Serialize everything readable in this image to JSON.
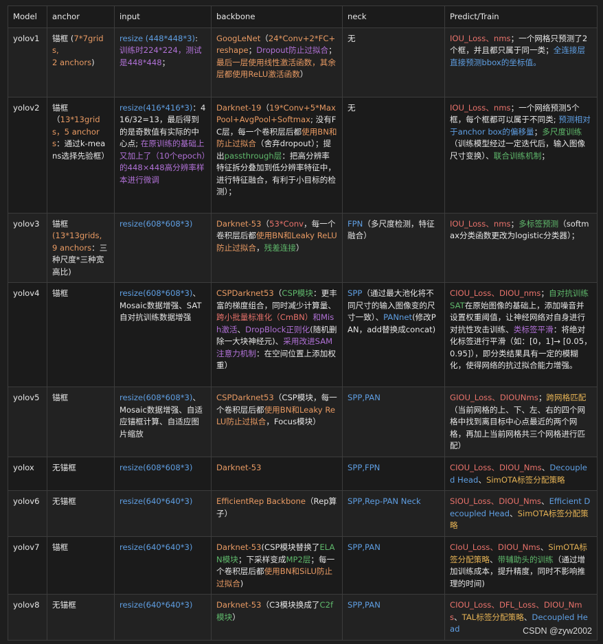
{
  "colors": {
    "text": "#e6e6e6",
    "orange": "#e89a63",
    "blue": "#5f9fe3",
    "green": "#5fb86b",
    "purple": "#b071d6",
    "red": "#e8726b",
    "yellow": "#e3b154",
    "cyan": "#4fc1c9"
  },
  "table": {
    "headers": [
      "Model",
      "anchor",
      "input",
      "backbone",
      "neck",
      "Predict/Train"
    ],
    "rows": [
      {
        "model": "yolov1",
        "anchor": [
          {
            "t": "锚框 ("
          },
          {
            "t": "7*7grids,\n2 anchors",
            "c": "orange"
          },
          {
            "t": ")"
          }
        ],
        "input": [
          {
            "t": "resize (448*448*3)",
            "c": "blue"
          },
          {
            "t": ": "
          },
          {
            "t": "训练时224*224，测试是448*448",
            "c": "purple"
          },
          {
            "t": "；"
          }
        ],
        "backbone": [
          {
            "t": "GoogLeNet",
            "c": "orange"
          },
          {
            "t": "（"
          },
          {
            "t": "24*Conv+2*FC+reshape",
            "c": "orange"
          },
          {
            "t": "；"
          },
          {
            "t": "Dropout防止过拟合",
            "c": "purple"
          },
          {
            "t": "；"
          },
          {
            "t": "最后一层使用线性激活函数，其余层都使用ReLU激活函数",
            "c": "orange"
          },
          {
            "t": "）"
          }
        ],
        "neck": [
          {
            "t": "无"
          }
        ],
        "predict": [
          {
            "t": "IOU_Loss、nms",
            "c": "red"
          },
          {
            "t": "；一个网格只预测了2个框，并且都只属于同一类；"
          },
          {
            "t": "全连接层直接预测bbox的坐标值。",
            "c": "blue"
          }
        ]
      },
      {
        "model": "yolov2",
        "anchor": [
          {
            "t": "锚框\n（"
          },
          {
            "t": "13*13grids，5 anchors",
            "c": "orange"
          },
          {
            "t": "：通过k-means选择先验框）"
          }
        ],
        "input": [
          {
            "t": "resize(416*416*3)",
            "c": "blue"
          },
          {
            "t": "：416/32=13，最后得到的是奇数值有实际的中心点; "
          },
          {
            "t": "在原训练的基础上又加上了（10个epoch）的448×448高分辨率样本进行微调",
            "c": "purple"
          }
        ],
        "backbone": [
          {
            "t": "Darknet-19",
            "c": "orange"
          },
          {
            "t": "（"
          },
          {
            "t": "19*Conv+5*MaxPool+AvgPool+Softmax",
            "c": "orange"
          },
          {
            "t": "; 没有FC层，每一个卷积层后都"
          },
          {
            "t": "使用BN和防止过拟合",
            "c": "orange"
          },
          {
            "t": "（舍弃dropout）；提出"
          },
          {
            "t": "passthrough层",
            "c": "green"
          },
          {
            "t": "：把高分辨率特征拆分叠加到低分辨率特征中，进行特征融合，有利于小目标的检测）；"
          }
        ],
        "neck": [
          {
            "t": "无"
          }
        ],
        "predict": [
          {
            "t": "IOU_Loss、nms",
            "c": "red"
          },
          {
            "t": "；一个网络预测5个框，每个框都可以属于不同类; "
          },
          {
            "t": "预测相对于anchor box的偏移量",
            "c": "blue"
          },
          {
            "t": "；"
          },
          {
            "t": "多尺度训练",
            "c": "green"
          },
          {
            "t": "（训练模型经过一定迭代后，输入图像尺寸变换）、"
          },
          {
            "t": "联合训练机制",
            "c": "green"
          },
          {
            "t": "；"
          }
        ]
      },
      {
        "model": "yolov3",
        "anchor": [
          {
            "t": "锚框\n"
          },
          {
            "t": "(13*13grids, 9 anchors",
            "c": "orange"
          },
          {
            "t": "：三种尺度*三种宽高比)"
          }
        ],
        "input": [
          {
            "t": "resize(608*608*3)",
            "c": "blue"
          }
        ],
        "backbone": [
          {
            "t": "Darknet-53",
            "c": "orange"
          },
          {
            "t": "（"
          },
          {
            "t": "53*Conv",
            "c": "red"
          },
          {
            "t": "，每一个卷积层后都"
          },
          {
            "t": "使用BN和Leaky ReLU防止过拟合",
            "c": "orange"
          },
          {
            "t": "，"
          },
          {
            "t": "残差连接",
            "c": "green"
          },
          {
            "t": "）"
          }
        ],
        "neck": [
          {
            "t": "FPN",
            "c": "blue"
          },
          {
            "t": "（多尺度检测，特征融合）"
          }
        ],
        "predict": [
          {
            "t": "IOU_Loss、nms",
            "c": "red"
          },
          {
            "t": "；"
          },
          {
            "t": "多标签预测",
            "c": "green"
          },
          {
            "t": "（softmax分类函数更改为logistic分类器）；"
          }
        ]
      },
      {
        "model": "yolov4",
        "anchor": [
          {
            "t": "锚框"
          }
        ],
        "input": [
          {
            "t": "resize(608*608*3)",
            "c": "blue"
          },
          {
            "t": "、Mosaic数据增强、SAT自对抗训练数据增强"
          }
        ],
        "backbone": [
          {
            "t": "CSPDarknet53",
            "c": "orange"
          },
          {
            "t": "（"
          },
          {
            "t": "CSP模块",
            "c": "green"
          },
          {
            "t": "：更丰富的梯度组合，同时减少计算量、"
          },
          {
            "t": "跨小批量标准化（CmBN）",
            "c": "red"
          },
          {
            "t": "和Mish激活",
            "c": "purple"
          },
          {
            "t": "、"
          },
          {
            "t": "DropBlock正则化",
            "c": "purple"
          },
          {
            "t": "(随机删除一大块神经元)、"
          },
          {
            "t": "采用改进SAM注意力机制",
            "c": "purple"
          },
          {
            "t": "：在空间位置上添加权重）"
          }
        ],
        "neck": [
          {
            "t": "SPP",
            "c": "blue"
          },
          {
            "t": "（通过最大池化将不同尺寸的输入图像变的尺寸一致）、"
          },
          {
            "t": "PANnet",
            "c": "blue"
          },
          {
            "t": "(修改PAN，add替换成concat)"
          }
        ],
        "predict": [
          {
            "t": "CIOU_Loss、DIOU_nms",
            "c": "red"
          },
          {
            "t": "；"
          },
          {
            "t": "自对抗训练SAT",
            "c": "green"
          },
          {
            "t": "在原始图像的基础上，添加噪音并设置权重阈值，让神经网络对自身进行对抗性攻击训练、"
          },
          {
            "t": "类标签平滑",
            "c": "purple"
          },
          {
            "t": "：将绝对化标签进行平滑（如：[0，1]→ [0.05，0.95]），即分类结果具有一定的模糊化，使得网络的抗过拟合能力增强。"
          }
        ]
      },
      {
        "model": "yolov5",
        "anchor": [
          {
            "t": "锚框"
          }
        ],
        "input": [
          {
            "t": "resize(608*608*3)",
            "c": "blue"
          },
          {
            "t": "、Mosaic数据增强、自适应锚框计算、自适应图片缩放"
          }
        ],
        "backbone": [
          {
            "t": "CSPDarknet53",
            "c": "orange"
          },
          {
            "t": "（CSP模块，每一个卷积层后都"
          },
          {
            "t": "使用BN和Leaky ReLU防止过拟合",
            "c": "orange"
          },
          {
            "t": "，Focus模块）"
          }
        ],
        "neck": [
          {
            "t": "SPP,PAN",
            "c": "blue"
          }
        ],
        "predict": [
          {
            "t": "GIOU_Loss、DIOUNms",
            "c": "red"
          },
          {
            "t": "；"
          },
          {
            "t": "跨网格匹配",
            "c": "yellow"
          },
          {
            "t": "（当前网格的上、下、左、右的四个网格中找到离目标中心点最近的两个网格，再加上当前网格共三个网格进行匹配）"
          }
        ]
      },
      {
        "model": "yolox",
        "anchor": [
          {
            "t": "无锚框"
          }
        ],
        "input": [
          {
            "t": "resize(608*608*3)",
            "c": "blue"
          }
        ],
        "backbone": [
          {
            "t": "Darknet-53",
            "c": "orange"
          }
        ],
        "neck": [
          {
            "t": "SPP,FPN",
            "c": "blue"
          }
        ],
        "predict": [
          {
            "t": "CIOU_Loss、DIOU_Nms",
            "c": "red"
          },
          {
            "t": "、"
          },
          {
            "t": "Decoupled Head",
            "c": "blue"
          },
          {
            "t": "、"
          },
          {
            "t": "SimOTA标签分配策略",
            "c": "yellow"
          }
        ]
      },
      {
        "model": "yolov6",
        "anchor": [
          {
            "t": "无锚框"
          }
        ],
        "input": [
          {
            "t": "resize(640*640*3)",
            "c": "blue"
          }
        ],
        "backbone": [
          {
            "t": "EfficientRep Backbone",
            "c": "orange"
          },
          {
            "t": "（Rep算子）"
          }
        ],
        "neck": [
          {
            "t": "SPP,Rep-PAN Neck",
            "c": "blue"
          }
        ],
        "predict": [
          {
            "t": "SIOU_Loss、DIOU_Nms",
            "c": "red"
          },
          {
            "t": "、"
          },
          {
            "t": "Efficient Decoupled Head",
            "c": "blue"
          },
          {
            "t": "、"
          },
          {
            "t": "SimOTA标签分配策略",
            "c": "yellow"
          }
        ]
      },
      {
        "model": "yolov7",
        "anchor": [
          {
            "t": "锚框"
          }
        ],
        "input": [
          {
            "t": "resize(640*640*3)",
            "c": "blue"
          }
        ],
        "backbone": [
          {
            "t": "Darknet-53",
            "c": "orange"
          },
          {
            "t": "(CSP模块替换了"
          },
          {
            "t": "ELAN模块",
            "c": "green"
          },
          {
            "t": "；下采样变成"
          },
          {
            "t": "MP2层",
            "c": "green"
          },
          {
            "t": "；每一个卷积层后都"
          },
          {
            "t": "使用BN和SiLU防止过拟合",
            "c": "orange"
          },
          {
            "t": ")"
          }
        ],
        "neck": [
          {
            "t": "SPP,PAN",
            "c": "blue"
          }
        ],
        "predict": [
          {
            "t": "CIoU_Loss、DIOU_Nms",
            "c": "red"
          },
          {
            "t": "、"
          },
          {
            "t": "SimOTA标签分配策略",
            "c": "yellow"
          },
          {
            "t": "、"
          },
          {
            "t": "带辅助头的训练",
            "c": "green"
          },
          {
            "t": "（通过增加训练成本，提升精度，同时不影响推理的时间)"
          }
        ]
      },
      {
        "model": "yolov8",
        "anchor": [
          {
            "t": "无锚框"
          }
        ],
        "input": [
          {
            "t": "resize(640*640*3)",
            "c": "blue"
          }
        ],
        "backbone": [
          {
            "t": "Darknet-53",
            "c": "orange"
          },
          {
            "t": "（C3模块换成了"
          },
          {
            "t": "C2f模块",
            "c": "green"
          },
          {
            "t": "）"
          }
        ],
        "neck": [
          {
            "t": "SPP,PAN",
            "c": "blue"
          }
        ],
        "predict": [
          {
            "t": "CIOU_Loss、DFL_Loss、DIOU_Nms",
            "c": "red"
          },
          {
            "t": "、"
          },
          {
            "t": "TAL标签分配策略",
            "c": "yellow"
          },
          {
            "t": "、"
          },
          {
            "t": "Decoupled Head",
            "c": "blue"
          }
        ]
      }
    ]
  },
  "watermark": "CSDN @zyw2002"
}
